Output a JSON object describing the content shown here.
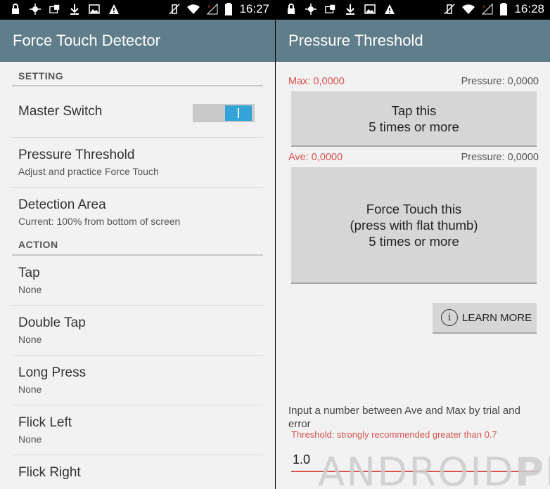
{
  "left": {
    "status_time": "16:27",
    "title": "Force Touch Detector",
    "sections": {
      "setting_header": "SETTING",
      "action_header": "ACTION"
    },
    "master_switch": "Master Switch",
    "prefs": [
      {
        "title": "Pressure Threshold",
        "summary": "Adjust and practice Force Touch"
      },
      {
        "title": "Detection Area",
        "summary": "Current: 100% from bottom of screen"
      }
    ],
    "actions": [
      {
        "title": "Tap",
        "summary": "None"
      },
      {
        "title": "Double Tap",
        "summary": "None"
      },
      {
        "title": "Long Press",
        "summary": "None"
      },
      {
        "title": "Flick Left",
        "summary": "None"
      },
      {
        "title": "Flick Right",
        "summary": ""
      }
    ]
  },
  "right": {
    "status_time": "16:28",
    "title": "Pressure Threshold",
    "max_label": "Max: 0,0000",
    "pressure_label_1": "Pressure: 0,0000",
    "tap_line1": "Tap this",
    "tap_line2": "5 times or more",
    "ave_label": "Ave: 0,0000",
    "pressure_label_2": "Pressure: 0,0000",
    "force_line1": "Force Touch this",
    "force_line2": "(press with flat thumb)",
    "force_line3": "5 times or more",
    "learn_more": "LEARN MORE",
    "hint": "Input a number between Ave and Max by trial and error",
    "warning": "Threshold: strongly recommended greater than 0.7",
    "threshold_value": "1.0",
    "watermark_part1": "ANDROID",
    "watermark_part2": "PIT"
  },
  "colors": {
    "appbar": "#607d8b",
    "accent": "#33a3d8",
    "warning": "#d9534f"
  }
}
